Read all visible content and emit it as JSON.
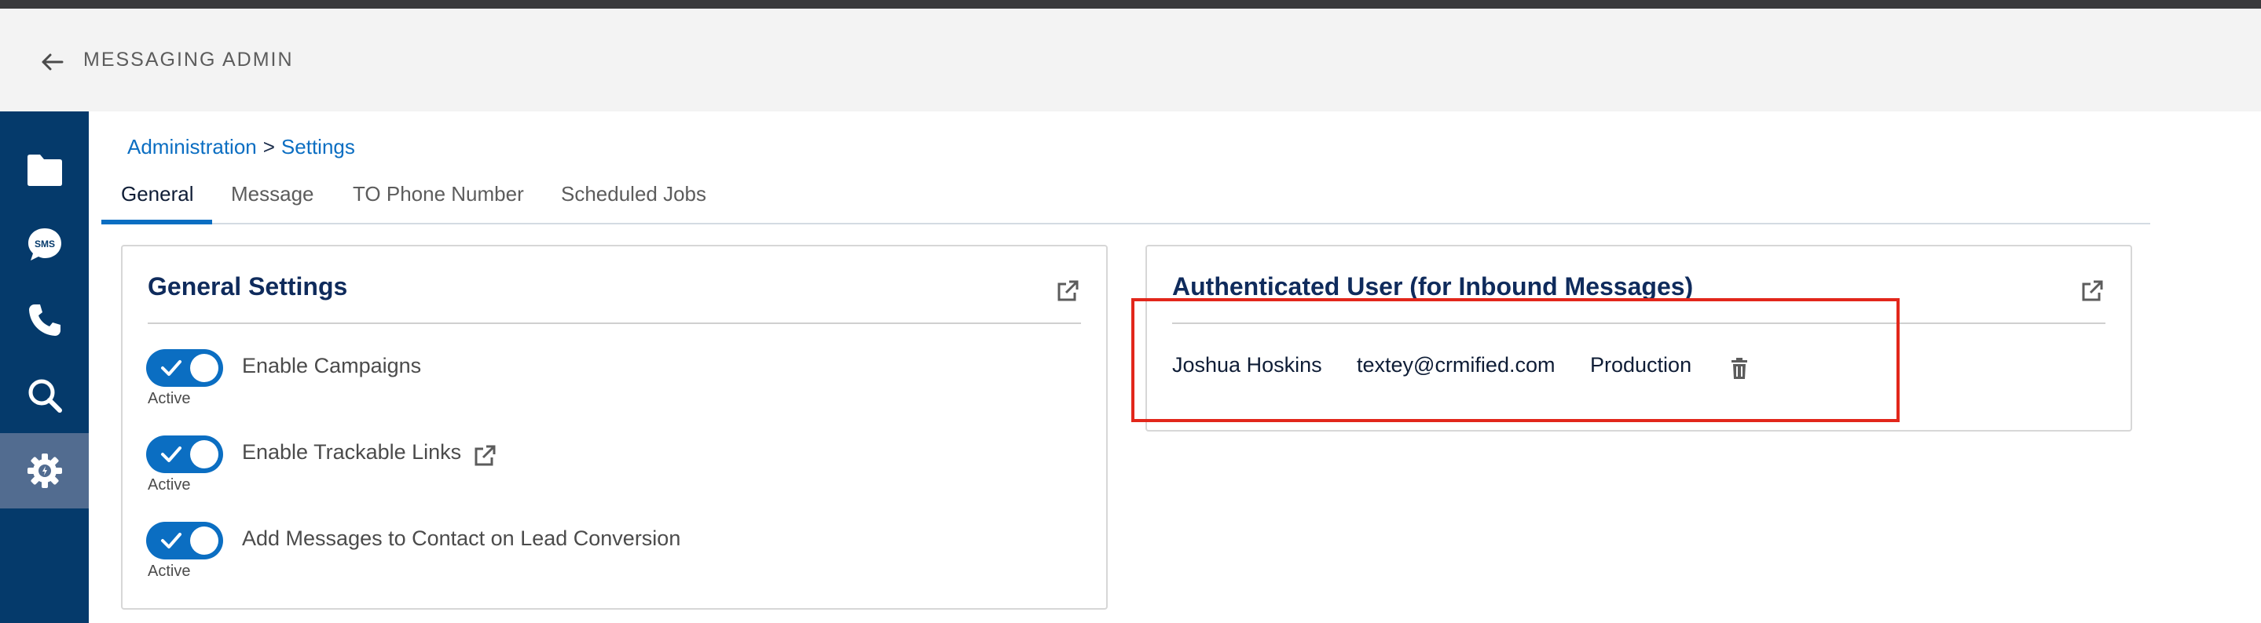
{
  "header": {
    "app_title": "MESSAGING ADMIN",
    "back_icon": "arrow-left-icon"
  },
  "sidebar": {
    "items": [
      {
        "icon": "folder-icon",
        "active": false
      },
      {
        "icon": "sms-icon",
        "active": false
      },
      {
        "icon": "phone-icon",
        "active": false
      },
      {
        "icon": "search-icon",
        "active": false
      },
      {
        "icon": "gear-icon",
        "active": true
      }
    ]
  },
  "breadcrumb": {
    "root": "Administration",
    "separator": ">",
    "current": "Settings"
  },
  "tabs": [
    {
      "label": "General",
      "active": true
    },
    {
      "label": "Message",
      "active": false
    },
    {
      "label": "TO Phone Number",
      "active": false
    },
    {
      "label": "Scheduled Jobs",
      "active": false
    }
  ],
  "general_settings": {
    "title": "General Settings",
    "items": [
      {
        "label": "Enable Campaigns",
        "status": "Active",
        "enabled": true
      },
      {
        "label": "Enable Trackable Links",
        "status": "Active",
        "enabled": true
      },
      {
        "label": "Add Messages to Contact on Lead Conversion",
        "status": "Active",
        "enabled": true
      }
    ]
  },
  "auth_user": {
    "title": "Authenticated User (for Inbound Messages)",
    "name": "Joshua Hoskins",
    "email": "textey@crmified.com",
    "environment": "Production"
  },
  "colors": {
    "sidebar": "#053a6b",
    "sidebar_active": "#526c90",
    "accent": "#0b6ec2",
    "title": "#0f2b5c",
    "highlight": "#e2271b"
  }
}
